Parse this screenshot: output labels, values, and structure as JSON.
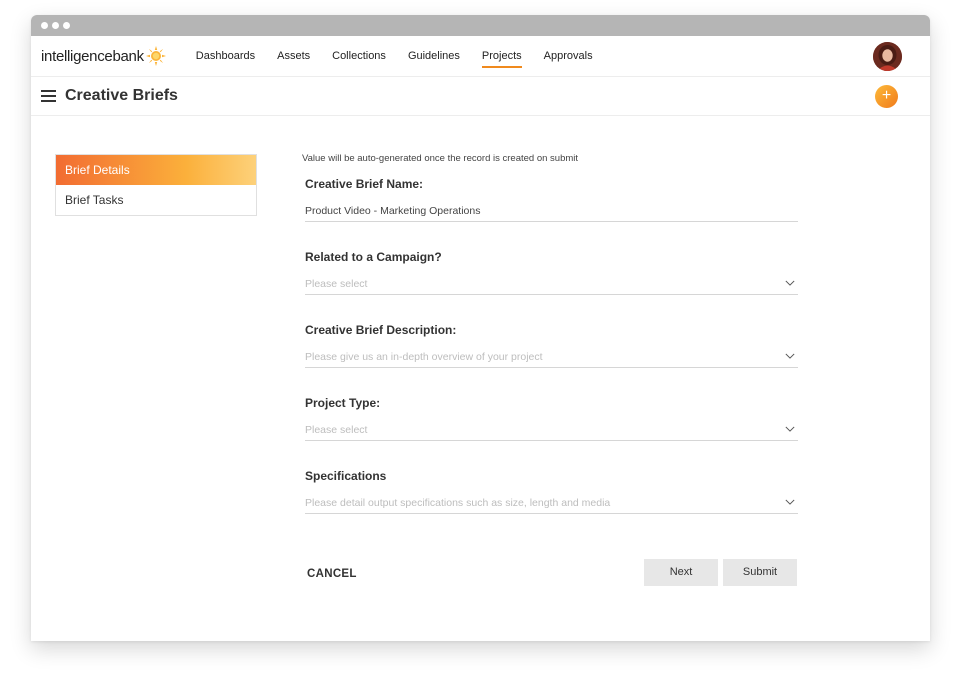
{
  "brand": {
    "logo_text": "intelligencebank",
    "accent": "#f08a1d"
  },
  "nav": {
    "items": [
      {
        "label": "Dashboards",
        "active": false
      },
      {
        "label": "Assets",
        "active": false
      },
      {
        "label": "Collections",
        "active": false
      },
      {
        "label": "Guidelines",
        "active": false
      },
      {
        "label": "Projects",
        "active": true
      },
      {
        "label": "Approvals",
        "active": false
      }
    ]
  },
  "page": {
    "title": "Creative Briefs",
    "add_icon": "plus-icon"
  },
  "sidebar": {
    "items": [
      {
        "label": "Brief Details",
        "active": true
      },
      {
        "label": "Brief Tasks",
        "active": false
      }
    ]
  },
  "form": {
    "auto_note": "Value will be auto-generated once the record is created on submit",
    "fields": [
      {
        "label": "Creative Brief Name:",
        "value": "Product Video - Marketing Operations",
        "placeholder": ""
      },
      {
        "label": "Related to a Campaign?",
        "value": "",
        "placeholder": "Please select"
      },
      {
        "label": "Creative Brief Description:",
        "value": "",
        "placeholder": "Please give us an in-depth overview of your project"
      },
      {
        "label": "Project Type:",
        "value": "",
        "placeholder": "Please select"
      },
      {
        "label": "Specifications",
        "value": "",
        "placeholder": "Please detail output specifications such as size, length and media"
      }
    ]
  },
  "actions": {
    "cancel": "CANCEL",
    "next": "Next",
    "submit": "Submit"
  }
}
